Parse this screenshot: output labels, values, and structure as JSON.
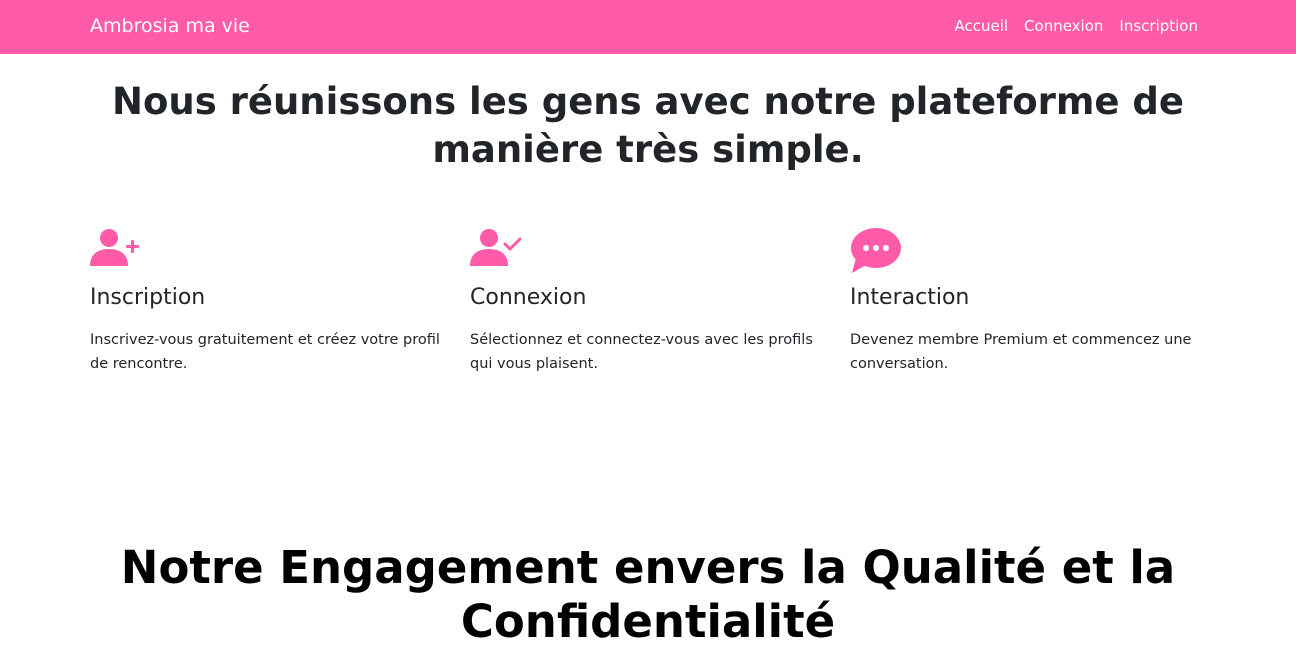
{
  "navbar": {
    "brand": "Ambrosia ma vie",
    "links": [
      "Accueil",
      "Connexion",
      "Inscription"
    ],
    "background": "#ff5ba8"
  },
  "hero": {
    "title": "Nous réunissons les gens avec notre plateforme de manière très simple."
  },
  "features": [
    {
      "icon": "user-plus-icon",
      "title": "Inscription",
      "text": "Inscrivez-vous gratuitement et créez votre profil de rencontre."
    },
    {
      "icon": "user-check-icon",
      "title": "Connexion",
      "text": "Sélectionnez et connectez-vous avec les profils qui vous plaisent."
    },
    {
      "icon": "chat-bubble-icon",
      "title": "Interaction",
      "text": "Devenez membre Premium et commencez une conversation."
    }
  ],
  "engagement": {
    "title": "Notre Engagement envers la Qualité et la Confidentialité"
  },
  "colors": {
    "accent": "#ff5ba8",
    "text": "#212529"
  }
}
